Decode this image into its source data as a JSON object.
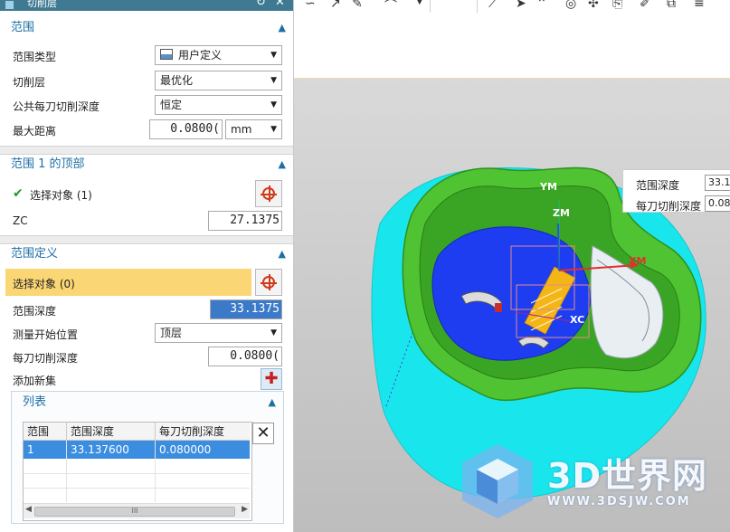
{
  "dialog": {
    "title": "切削层",
    "reset_icon": "reset-icon",
    "close_icon": "close-icon"
  },
  "range": {
    "header": "范围",
    "type_label": "范围类型",
    "type_value": "用户定义",
    "cut_layer_label": "切削层",
    "cut_layer_value": "最优化",
    "common_depth_label": "公共每刀切削深度",
    "common_depth_value": "恒定",
    "max_distance_label": "最大距离",
    "max_distance_value": "0.0800(",
    "max_distance_unit": "mm"
  },
  "range_top": {
    "header": "范围 1 的顶部",
    "select_label": "选择对象 (1)",
    "zc_label": "ZC",
    "zc_value": "27.1375"
  },
  "range_def": {
    "header": "范围定义",
    "select_label": "选择对象 (0)",
    "depth_label": "范围深度",
    "depth_value": "33.1375",
    "measure_label": "测量开始位置",
    "measure_value": "顶层",
    "per_cut_label": "每刀切削深度",
    "per_cut_value": "0.0800(",
    "add_set_label": "添加新集"
  },
  "list": {
    "header": "列表",
    "columns": [
      "范围",
      "范围深度",
      "每刀切削深度"
    ],
    "rows": [
      [
        "1",
        "33.137600",
        "0.080000"
      ]
    ],
    "scroll_glyph": "III"
  },
  "viewport_overlay": {
    "depth_label": "范围深度",
    "depth_value": "33.1",
    "per_cut_label": "每刀切削深度",
    "per_cut_value": "0.08("
  },
  "axes": {
    "ym": "YM",
    "zm": "ZM",
    "xm": "XM",
    "xc": "XC"
  },
  "watermark": {
    "name": "3D世界网",
    "url": "WWW.3DSJW.COM"
  },
  "colors": {
    "title_bar": "#3f7a92",
    "section_header": "#1d6fa5",
    "highlight": "#fbd675",
    "selection": "#3b8de0",
    "part_green": "#4fc331",
    "stock_cyan": "#19e6ec",
    "floor_blue": "#1e3df0"
  }
}
